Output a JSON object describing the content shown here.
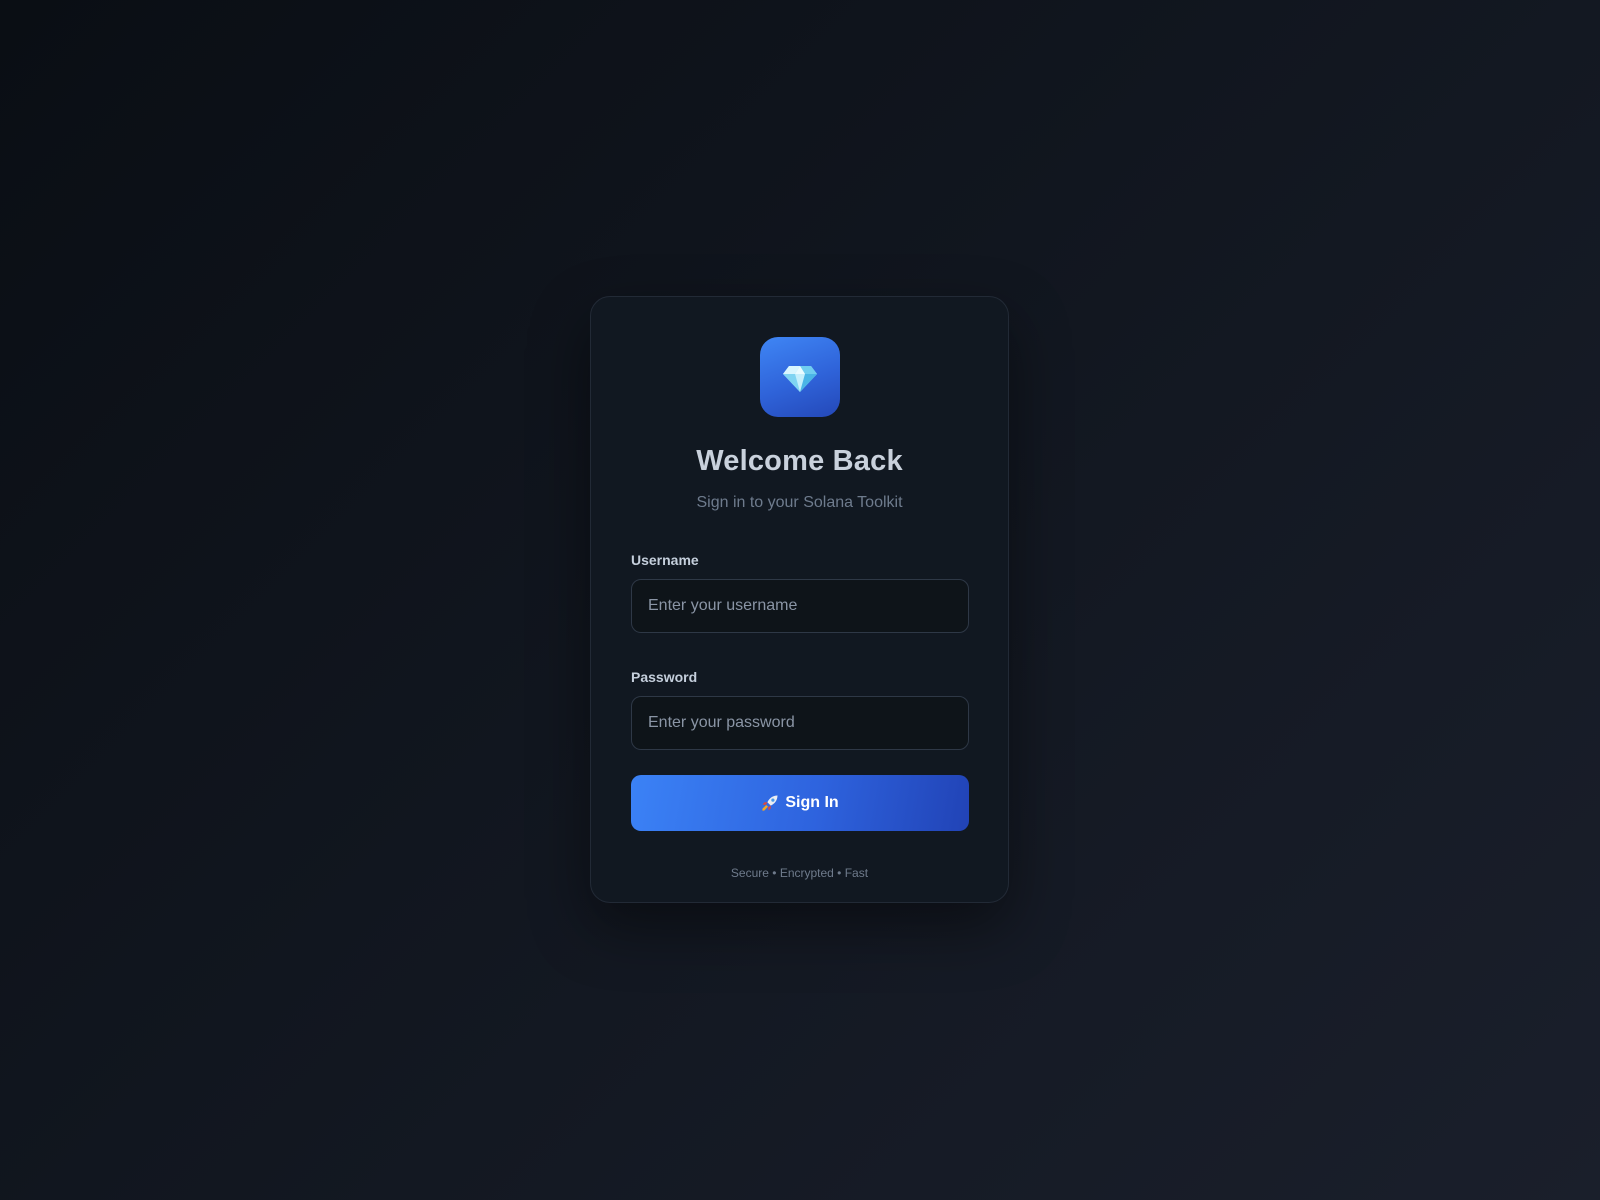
{
  "login": {
    "logo_icon": "gem-icon",
    "title": "Welcome Back",
    "subtitle": "Sign in to your Solana Toolkit",
    "username": {
      "label": "Username",
      "placeholder": "Enter your username",
      "value": ""
    },
    "password": {
      "label": "Password",
      "placeholder": "Enter your password",
      "value": ""
    },
    "submit": {
      "icon": "rocket-icon",
      "label": "Sign In"
    },
    "footer": "Secure • Encrypted • Fast"
  },
  "colors": {
    "accent": "#3b82f6",
    "accent_dark": "#2143b6",
    "card_background": "#111821",
    "page_background": "#0f141c"
  }
}
